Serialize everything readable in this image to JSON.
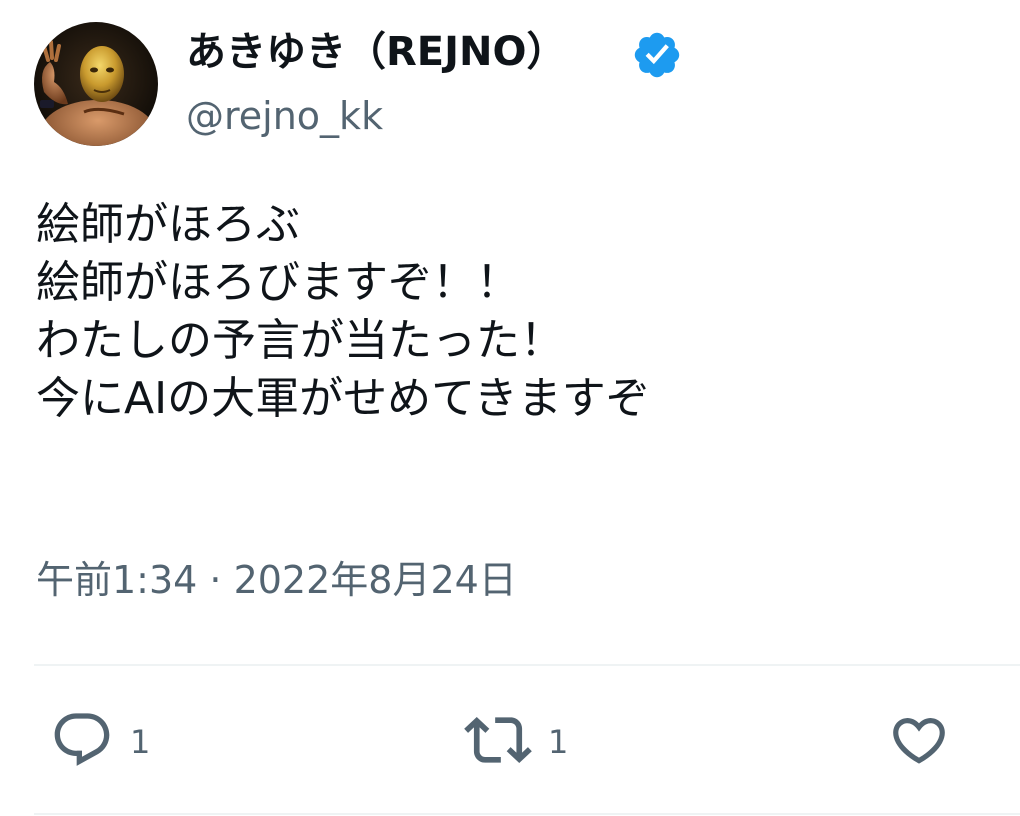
{
  "tweet": {
    "display_name": "あきゆき（REJNO）",
    "handle": "@rejno_kk",
    "verified": true,
    "avatar_icon": "avatar-image",
    "text_lines": [
      "絵師がほろぶ",
      "絵師がほろびますぞ！！",
      "わたしの予言が当たった！",
      "今にAIの大軍がせめてきますぞ"
    ],
    "timestamp": "午前1:34 · 2022年8月24日"
  },
  "actions": {
    "reply": {
      "icon": "reply-icon",
      "count": "1"
    },
    "retweet": {
      "icon": "retweet-icon",
      "count": "1"
    },
    "like": {
      "icon": "heart-icon",
      "count": ""
    }
  },
  "colors": {
    "text_primary": "#0f1419",
    "text_secondary": "#536471",
    "verified_blue": "#1d9bf0",
    "divider": "#eff3f4"
  }
}
